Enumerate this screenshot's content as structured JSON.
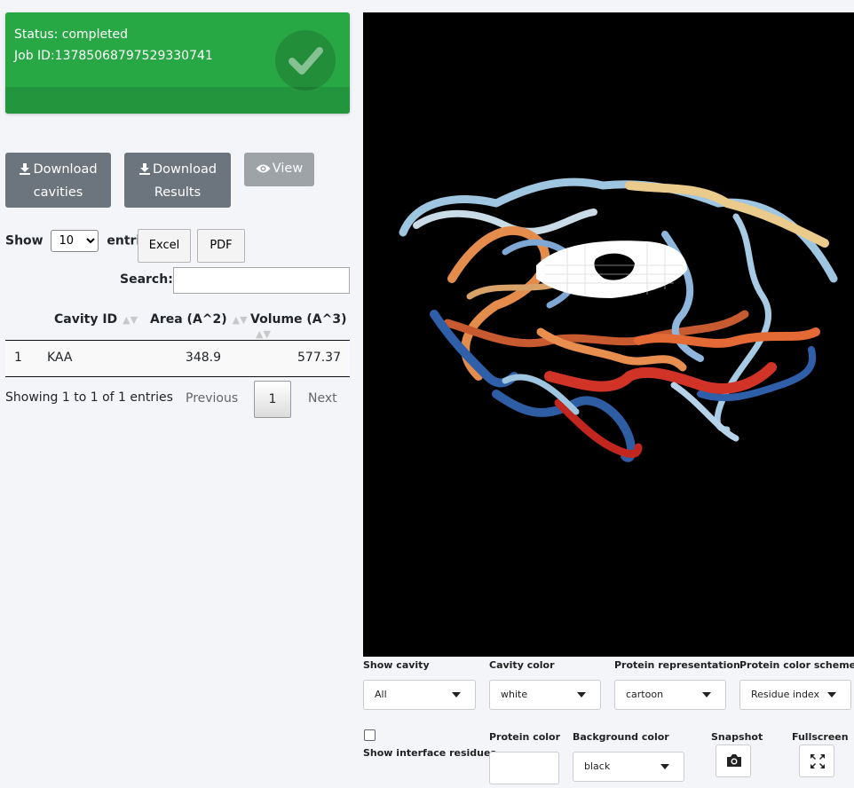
{
  "status": {
    "status_text": "Status: completed",
    "job_text": "Job ID:13785068797529330741",
    "icon": "check-circle-icon",
    "color": "#28a745"
  },
  "actions": {
    "download_cavities_line1": "Download",
    "download_cavities_line2": "cavities",
    "download_results_line1": "Download",
    "download_results_line2": "Results",
    "view_label": "View"
  },
  "table_controls": {
    "show_label": "Show",
    "page_size": "10",
    "entries_label": "entries",
    "excel_label": "Excel",
    "pdf_label": "PDF",
    "search_label": "Search:",
    "search_value": ""
  },
  "table": {
    "columns": [
      "Cavity ID",
      "Area (A^2)",
      "Volume (A^3)"
    ],
    "rows": [
      {
        "index": "1",
        "cavity_id": "KAA",
        "area": "348.9",
        "volume": "577.37"
      }
    ]
  },
  "pagination": {
    "info": "Showing 1 to 1 of 1 entries",
    "previous": "Previous",
    "current": "1",
    "next": "Next"
  },
  "viewer": {
    "background": "#000000"
  },
  "controls": {
    "show_cavity_label": "Show cavity",
    "show_cavity_value": "All",
    "cavity_color_label": "Cavity color",
    "cavity_color_value": "white",
    "protein_rep_label": "Protein representation",
    "protein_rep_value": "cartoon",
    "protein_scheme_label": "Protein color scheme",
    "protein_scheme_value": "Residue index",
    "interface_label": "Show interface residues",
    "protein_color_label": "Protein color",
    "background_color_label": "Background color",
    "background_color_value": "black",
    "snapshot_label": "Snapshot",
    "fullscreen_label": "Fullscreen"
  }
}
